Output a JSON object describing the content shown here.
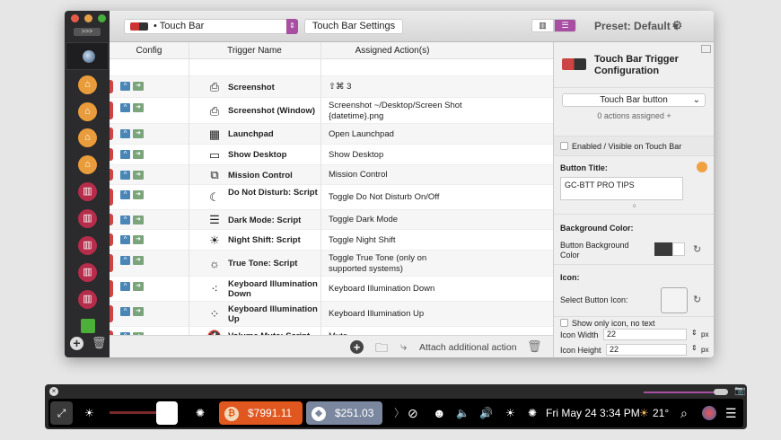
{
  "toolbar": {
    "selector": "• Touch Bar",
    "settings_button": "Touch Bar Settings",
    "preset": "Preset: Default ▾",
    "more_label": ">>>"
  },
  "table": {
    "headers": [
      "Config",
      "Trigger Name",
      "Assigned Action(s)"
    ],
    "rows": [
      {
        "icon": "screenshot-icon",
        "glyph": "⎙",
        "name": "Screenshot",
        "action": "⇧⌘ 3"
      },
      {
        "icon": "screenshot-window-icon",
        "glyph": "⎙",
        "name": "Screenshot (Window)",
        "action": "Screenshot ~/Desktop/Screen Shot {datetime}.png"
      },
      {
        "icon": "launchpad-icon",
        "glyph": "▦",
        "name": "Launchpad",
        "action": "Open Launchpad"
      },
      {
        "icon": "show-desktop-icon",
        "glyph": "▭",
        "name": "Show Desktop",
        "action": "Show Desktop"
      },
      {
        "icon": "mission-control-icon",
        "glyph": "⧉",
        "name": "Mission Control",
        "action": "Mission Control"
      },
      {
        "icon": "moon-icon",
        "glyph": "☾",
        "name": "Do Not Disturb: Script",
        "action": "Toggle Do Not Disturb On/Off"
      },
      {
        "icon": "dark-mode-icon",
        "glyph": "☰",
        "name": "Dark Mode: Script",
        "action": "Toggle Dark Mode"
      },
      {
        "icon": "night-shift-icon",
        "glyph": "☀",
        "name": "Night Shift: Script",
        "action": "Toggle Night Shift"
      },
      {
        "icon": "true-tone-icon",
        "glyph": "☼",
        "name": "True Tone: Script",
        "action": "Toggle True Tone (only on supported systems)"
      },
      {
        "icon": "keyboard-illumination-down-icon",
        "glyph": "⁖",
        "name": "Keyboard Illumination Down",
        "action": "Keyboard Illumination Down"
      },
      {
        "icon": "keyboard-illumination-up-icon",
        "glyph": "⁘",
        "name": "Keyboard Illumination Up",
        "action": "Keyboard Illumination Up"
      },
      {
        "icon": "volume-mute-icon",
        "glyph": "🔇",
        "name": "Volume Mute: Script",
        "action": "Mute"
      }
    ]
  },
  "bottom": {
    "attach": "Attach additional action"
  },
  "panel": {
    "title": "Touch Bar Trigger Configuration",
    "type": "Touch Bar button",
    "actions_assigned": "0 actions assigned +",
    "enabled_label": "Enabled / Visible on Touch Bar",
    "button_title_label": "Button Title:",
    "button_title_value": "GC-BTT PRO TIPS",
    "bg_color_heading": "Background Color:",
    "bg_color_label": "Button Background Color",
    "bg_color": "#3a3a3a",
    "icon_heading": "Icon:",
    "select_icon_label": "Select Button Icon:",
    "show_only_icon": "Show only icon, no text",
    "icon_width_label": "Icon Width",
    "icon_width": "22",
    "icon_height_label": "Icon Height",
    "icon_height": "22",
    "unit": "px"
  },
  "touchbar": {
    "bitcoin": "$7991.11",
    "ethereum": "$251.03",
    "datetime": "Fri May 24 3:34 PM",
    "temperature": "21°",
    "bitcoin_color": "#e0571f",
    "ethereum_color": "#7b879f",
    "accent": "#a84fa3"
  }
}
